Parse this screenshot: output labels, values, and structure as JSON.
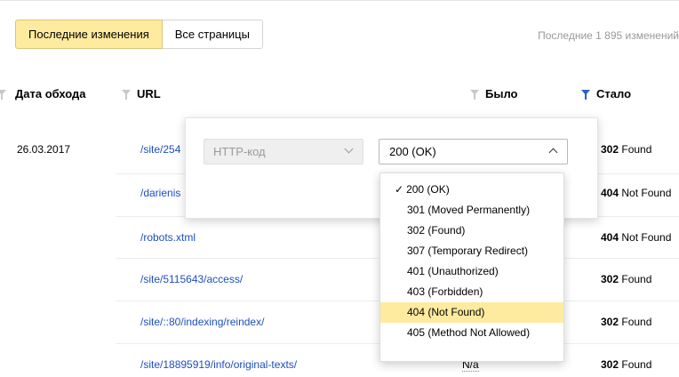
{
  "tabs": [
    {
      "label": "Последние изменения",
      "active": true
    },
    {
      "label": "Все страницы",
      "active": false
    }
  ],
  "summary": "Последние 1 895 изменений",
  "columns": {
    "date": "Дата обхода",
    "url": "URL",
    "was": "Было",
    "now": "Стало"
  },
  "rows": [
    {
      "date": "26.03.2017",
      "url": "/site/254",
      "was": "",
      "now_code": "302",
      "now_text": "Found"
    },
    {
      "date": "",
      "url": "/darienis",
      "was": "",
      "now_code": "404",
      "now_text": "Not Found"
    },
    {
      "date": "",
      "url": "/robots.xtml",
      "was": "",
      "now_code": "404",
      "now_text": "Not Found"
    },
    {
      "date": "",
      "url": "/site/5115643/access/",
      "was": "",
      "now_code": "302",
      "now_text": "Found"
    },
    {
      "date": "",
      "url": "/site/::80/indexing/reindex/",
      "was": "",
      "now_code": "302",
      "now_text": "Found"
    },
    {
      "date": "",
      "url": "/site/18895919/info/original-texts/",
      "was": "N/a",
      "now_code": "302",
      "now_text": "Found"
    }
  ],
  "filter": {
    "field_label": "HTTP-код",
    "value": "200 (OK)"
  },
  "dropdown": {
    "check": "✓",
    "options": [
      "200 (OK)",
      "301 (Moved Permanently)",
      "302 (Found)",
      "307 (Temporary Redirect)",
      "401 (Unauthorized)",
      "403 (Forbidden)",
      "404 (Not Found)",
      "405 (Method Not Allowed)"
    ],
    "checked_index": 0,
    "hover_index": 6
  },
  "colors": {
    "accent_yellow": "#ffeba0",
    "link_blue": "#1c4fbf",
    "filter_active": "#2962c4"
  }
}
